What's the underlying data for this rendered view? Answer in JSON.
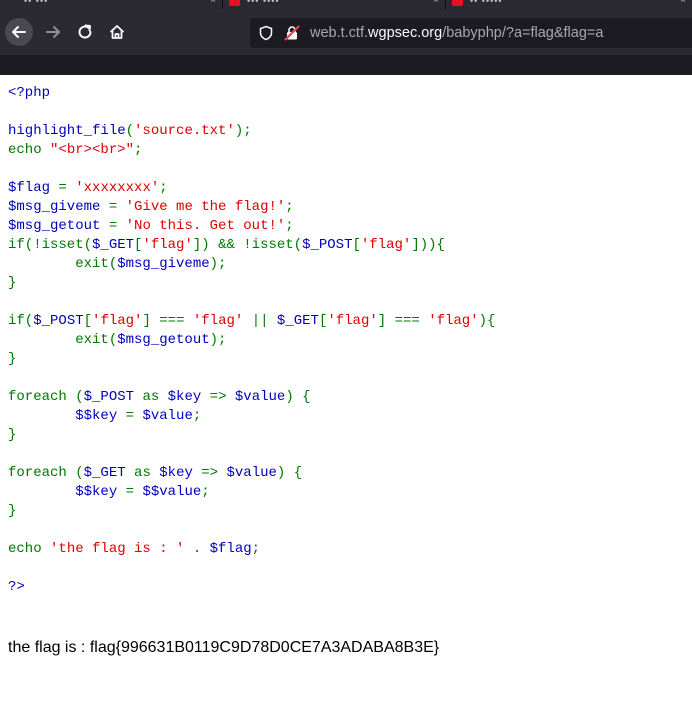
{
  "browser": {
    "url": {
      "host_prefix": "web.t.ctf.",
      "domain": "wgpsec.org",
      "path": "/babyphp/?a=flag&flag=a"
    }
  },
  "source_code": {
    "line_01": [
      {
        "c": "d",
        "t": "<?php"
      }
    ],
    "line_02": [],
    "line_03": [
      {
        "c": "d",
        "t": "highlight_file"
      },
      {
        "c": "k",
        "t": "("
      },
      {
        "c": "s",
        "t": "'source.txt'"
      },
      {
        "c": "k",
        "t": ");"
      }
    ],
    "line_04": [
      {
        "c": "k",
        "t": "echo "
      },
      {
        "c": "s",
        "t": "\"<br><br>\""
      },
      {
        "c": "k",
        "t": ";"
      }
    ],
    "line_05": [],
    "line_06": [
      {
        "c": "d",
        "t": "$flag "
      },
      {
        "c": "k",
        "t": "= "
      },
      {
        "c": "s",
        "t": "'xxxxxxxx'"
      },
      {
        "c": "k",
        "t": ";"
      }
    ],
    "line_07": [
      {
        "c": "d",
        "t": "$msg_giveme "
      },
      {
        "c": "k",
        "t": "= "
      },
      {
        "c": "s",
        "t": "'Give me the flag!'"
      },
      {
        "c": "k",
        "t": ";"
      }
    ],
    "line_08": [
      {
        "c": "d",
        "t": "$msg_getout "
      },
      {
        "c": "k",
        "t": "= "
      },
      {
        "c": "s",
        "t": "'No this. Get out!'"
      },
      {
        "c": "k",
        "t": ";"
      }
    ],
    "line_09": [
      {
        "c": "k",
        "t": "if(!isset("
      },
      {
        "c": "d",
        "t": "$_GET"
      },
      {
        "c": "k",
        "t": "["
      },
      {
        "c": "s",
        "t": "'flag'"
      },
      {
        "c": "k",
        "t": "]) && !isset("
      },
      {
        "c": "d",
        "t": "$_POST"
      },
      {
        "c": "k",
        "t": "["
      },
      {
        "c": "s",
        "t": "'flag'"
      },
      {
        "c": "k",
        "t": "])){"
      }
    ],
    "line_10": [
      {
        "c": "k",
        "t": "        exit("
      },
      {
        "c": "d",
        "t": "$msg_giveme"
      },
      {
        "c": "k",
        "t": ");"
      }
    ],
    "line_11": [
      {
        "c": "k",
        "t": "}"
      }
    ],
    "line_12": [],
    "line_13": [
      {
        "c": "k",
        "t": "if("
      },
      {
        "c": "d",
        "t": "$_POST"
      },
      {
        "c": "k",
        "t": "["
      },
      {
        "c": "s",
        "t": "'flag'"
      },
      {
        "c": "k",
        "t": "] === "
      },
      {
        "c": "s",
        "t": "'flag' "
      },
      {
        "c": "k",
        "t": "|| "
      },
      {
        "c": "d",
        "t": "$_GET"
      },
      {
        "c": "k",
        "t": "["
      },
      {
        "c": "s",
        "t": "'flag'"
      },
      {
        "c": "k",
        "t": "] === "
      },
      {
        "c": "s",
        "t": "'flag'"
      },
      {
        "c": "k",
        "t": "){"
      }
    ],
    "line_14": [
      {
        "c": "k",
        "t": "        exit("
      },
      {
        "c": "d",
        "t": "$msg_getout"
      },
      {
        "c": "k",
        "t": ");"
      }
    ],
    "line_15": [
      {
        "c": "k",
        "t": "}"
      }
    ],
    "line_16": [],
    "line_17": [
      {
        "c": "k",
        "t": "foreach ("
      },
      {
        "c": "d",
        "t": "$_POST "
      },
      {
        "c": "k",
        "t": "as "
      },
      {
        "c": "d",
        "t": "$key "
      },
      {
        "c": "k",
        "t": "=> "
      },
      {
        "c": "d",
        "t": "$value"
      },
      {
        "c": "k",
        "t": ") {"
      }
    ],
    "line_18": [
      {
        "c": "d",
        "t": "        $$key "
      },
      {
        "c": "k",
        "t": "= "
      },
      {
        "c": "d",
        "t": "$value"
      },
      {
        "c": "k",
        "t": ";"
      }
    ],
    "line_19": [
      {
        "c": "k",
        "t": "}"
      }
    ],
    "line_20": [],
    "line_21": [
      {
        "c": "k",
        "t": "foreach ("
      },
      {
        "c": "d",
        "t": "$_GET "
      },
      {
        "c": "k",
        "t": "as "
      },
      {
        "c": "d",
        "t": "$key "
      },
      {
        "c": "k",
        "t": "=> "
      },
      {
        "c": "d",
        "t": "$value"
      },
      {
        "c": "k",
        "t": ") {"
      }
    ],
    "line_22": [
      {
        "c": "d",
        "t": "        $$key "
      },
      {
        "c": "k",
        "t": "= "
      },
      {
        "c": "d",
        "t": "$$value"
      },
      {
        "c": "k",
        "t": ";"
      }
    ],
    "line_23": [
      {
        "c": "k",
        "t": "}"
      }
    ],
    "line_24": [],
    "line_25": [
      {
        "c": "k",
        "t": "echo "
      },
      {
        "c": "s",
        "t": "'the flag is : ' "
      },
      {
        "c": "k",
        "t": ". "
      },
      {
        "c": "d",
        "t": "$flag"
      },
      {
        "c": "k",
        "t": ";"
      }
    ],
    "line_26": [],
    "line_27": [
      {
        "c": "d",
        "t": "?>"
      }
    ]
  },
  "output": {
    "flag_line": "the flag is : flag{996631B0119C9D78D0CE7A3ADABA8B3E}"
  },
  "colors": {
    "php_default": "#0000bb",
    "php_keyword": "#007700",
    "php_string": "#dd0000",
    "chrome_toolbar": "#2b2a33",
    "chrome_dark": "#1c1b22"
  }
}
